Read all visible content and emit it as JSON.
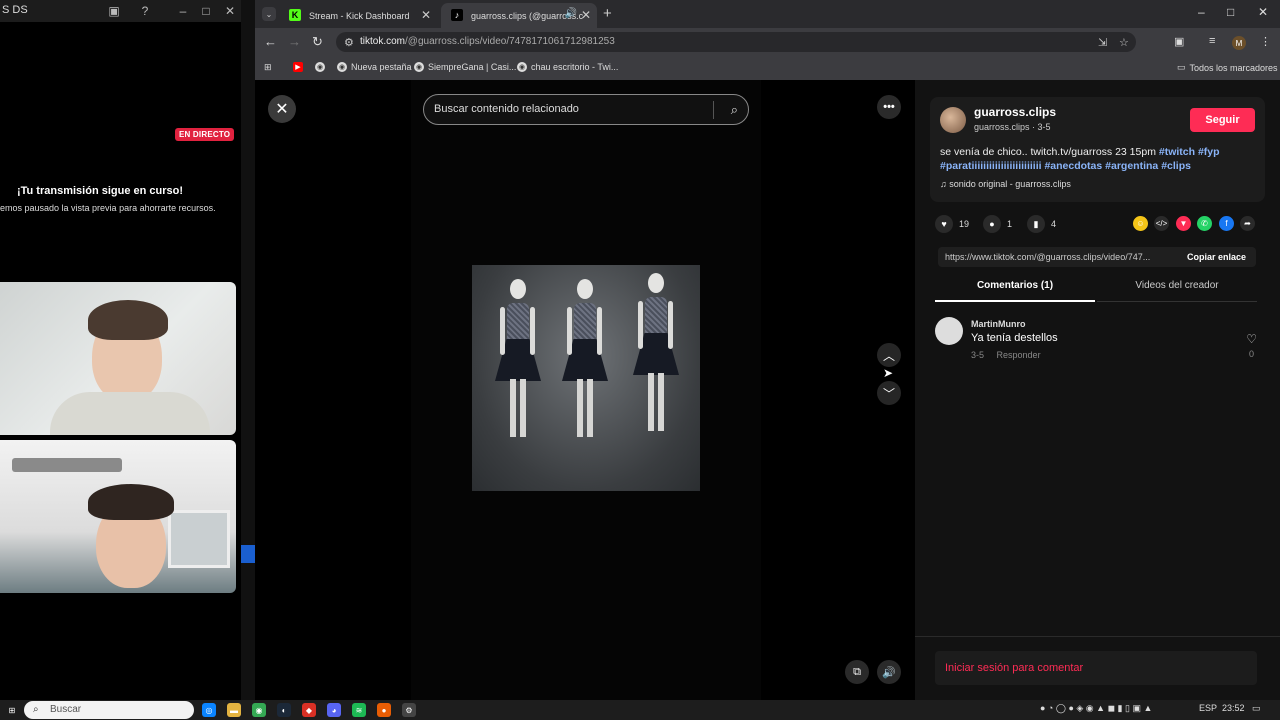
{
  "left_window": {
    "title_fragment": "S DS",
    "live_badge": "EN DIRECTO",
    "message_title": "¡Tu transmisión sigue en curso!",
    "message_sub": "emos pausado la vista previa para ahorrarte recursos."
  },
  "browser": {
    "tabs": [
      {
        "label": "Stream - Kick Dashboard",
        "favicon": "kick-icon",
        "color": "#53fc18"
      },
      {
        "label": "guarross.clips (@guarross.c",
        "favicon": "tiktok-icon",
        "color": "#ffffff"
      }
    ],
    "url_host": "tiktok.com",
    "url_path": "/@guarross.clips/video/7478171061712981253",
    "bookmarks": [
      "Nueva pestaña",
      "SiempreGana | Casi...",
      "chau escritorio - Twi..."
    ],
    "all_bookmarks": "Todos los marcadores",
    "profile_initial": "M"
  },
  "tiktok": {
    "search_placeholder": "Buscar contenido relacionado",
    "username": "guarross.clips",
    "subinfo": "guarross.clips · 3-5",
    "follow_label": "Seguir",
    "description": "se venía de chico.. twitch.tv/guarross 23 15pm",
    "hashtags": [
      "#twitch",
      "#fyp",
      "#paratiiiiiiiiiiiiiiiiiiiiiiii",
      "#anecdotas",
      "#argentina",
      "#clips"
    ],
    "sound": "sonido original - guarross.clips",
    "likes": "19",
    "comments_count": "1",
    "saves": "4",
    "share_colors": [
      "#f5c518",
      "#2a2a2a",
      "#fe2c55",
      "#25d366",
      "#1877f2",
      "#2a2a2a"
    ],
    "share_link": "https://www.tiktok.com/@guarross.clips/video/747...",
    "copy_link_label": "Copiar enlace",
    "tab_comments": "Comentarios (1)",
    "tab_creator_videos": "Videos del creador",
    "comment": {
      "user": "MartinMunro",
      "text": "Ya tenía destellos",
      "date": "3-5",
      "reply": "Responder",
      "likes": "0"
    },
    "login_prompt": "Iniciar sesión para comentar",
    "accent_color": "#fe2c55"
  },
  "taskbar": {
    "search_placeholder": "Buscar",
    "language": "ESP",
    "time": "23:52"
  }
}
